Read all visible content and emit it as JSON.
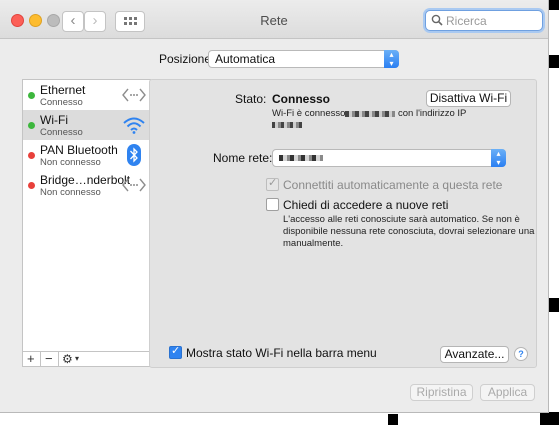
{
  "window": {
    "title": "Rete",
    "search_placeholder": "Ricerca"
  },
  "location": {
    "label": "Posizione:",
    "value": "Automatica"
  },
  "services": [
    {
      "name": "Ethernet",
      "status": "Connesso",
      "status_color": "#3db73d",
      "icon": "ethernet-arrows-icon"
    },
    {
      "name": "Wi-Fi",
      "status": "Connesso",
      "status_color": "#3db73d",
      "icon": "wifi-icon"
    },
    {
      "name": "PAN Bluetooth",
      "status": "Non connesso",
      "status_color": "#e8403a",
      "icon": "bluetooth-icon"
    },
    {
      "name": "Bridge…nderbolt",
      "status": "Non connesso",
      "status_color": "#e8403a",
      "icon": "bridge-arrows-icon"
    }
  ],
  "sidebar_toolbar": {
    "add": "+",
    "remove": "−",
    "actions": "⚙"
  },
  "status": {
    "label": "Stato:",
    "value": "Connesso",
    "toggle_button": "Disattiva Wi-Fi",
    "detail_prefix": "Wi-Fi è connesso a",
    "detail_middle": "con l'indirizzo IP"
  },
  "network": {
    "label": "Nome rete:"
  },
  "options": {
    "auto_join_label": "Connettiti automaticamente a questa rete",
    "auto_join_checked": true,
    "ask_join_label": "Chiedi di accedere a nuove reti",
    "ask_join_checked": false,
    "help_text_line1": "L'accesso alle reti conosciute sarà automatico. Se non è",
    "help_text_line2": "disponibile nessuna rete conosciuta, dovrai selezionare una",
    "help_text_line3": "manualmente."
  },
  "menu_bar_option": {
    "label": "Mostra stato Wi-Fi nella barra menu",
    "checked": true
  },
  "buttons": {
    "advanced": "Avanzate...",
    "help": "?",
    "revert": "Ripristina",
    "apply": "Applica"
  },
  "colors": {
    "accent": "#2f83f0",
    "connected": "#3db73d",
    "disconnected": "#e8403a"
  }
}
